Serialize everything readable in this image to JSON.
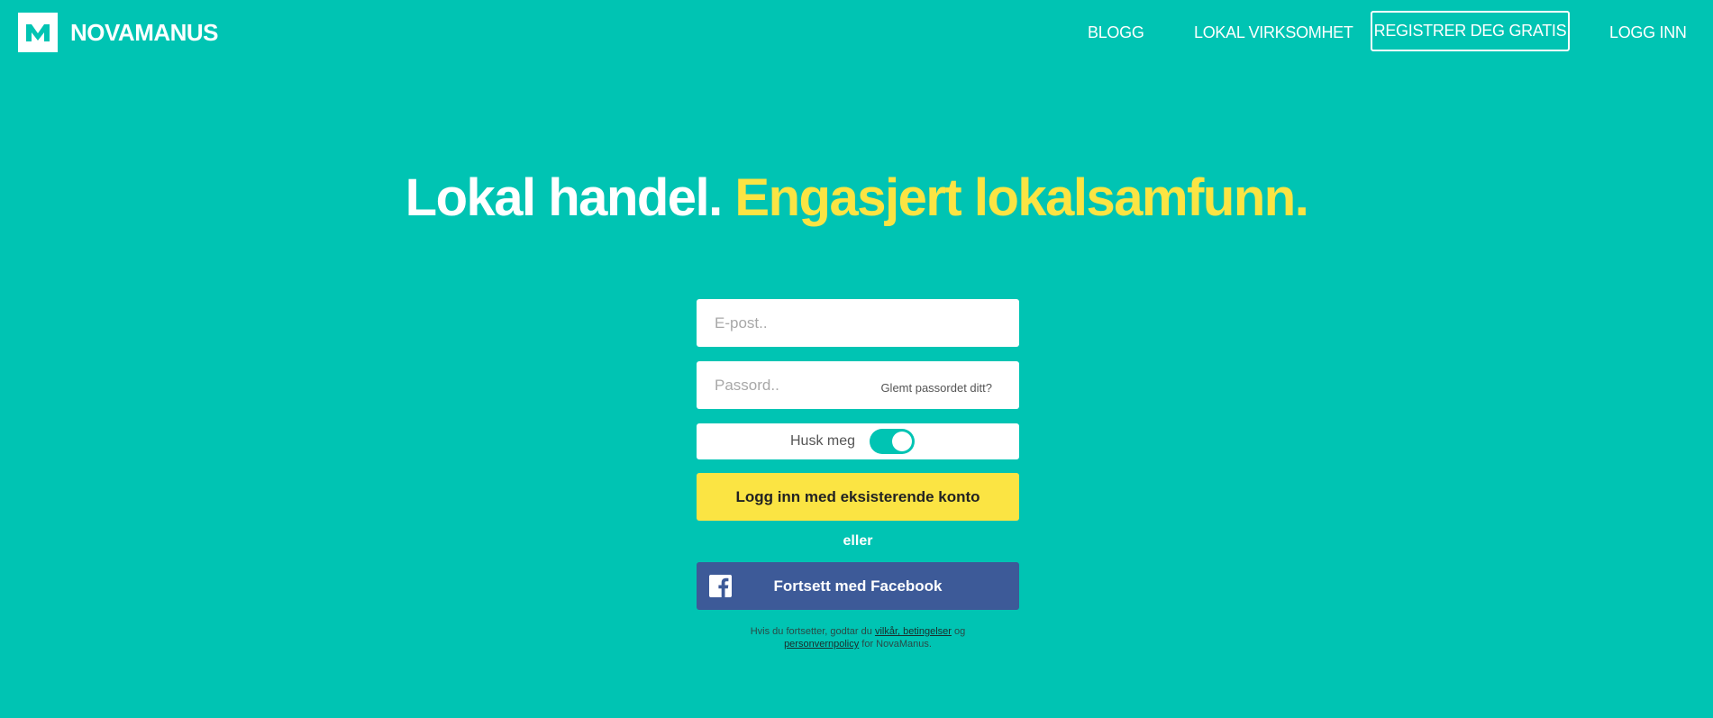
{
  "brand": {
    "logo_letter": "M",
    "name": "NOVAMANUS"
  },
  "nav": {
    "blogg": "BLOGG",
    "lokal": "LOKAL VIRKSOMHET",
    "register": "REGISTRER DEG GRATIS",
    "login": "LOGG INN"
  },
  "headline": {
    "part1": "Lokal handel.",
    "part2": "Engasjert lokalsamfunn."
  },
  "form": {
    "email_placeholder": "E-post..",
    "password_placeholder": "Passord..",
    "forgot_password": "Glemt passordet ditt?",
    "remember_label": "Husk meg",
    "remember_on": true,
    "login_button": "Logg inn med eksisterende konto",
    "or": "eller",
    "facebook_button": "Fortsett med Facebook"
  },
  "terms": {
    "prefix": "Hvis du fortsetter, godtar du",
    "terms_link": "vilkår, betingelser",
    "and": "og",
    "privacy_link": "personvernpolicy",
    "suffix": "for NovaManus."
  },
  "colors": {
    "background": "#00c4b3",
    "accent_yellow": "#fbe443",
    "facebook": "#3d5a98",
    "white": "#ffffff"
  }
}
